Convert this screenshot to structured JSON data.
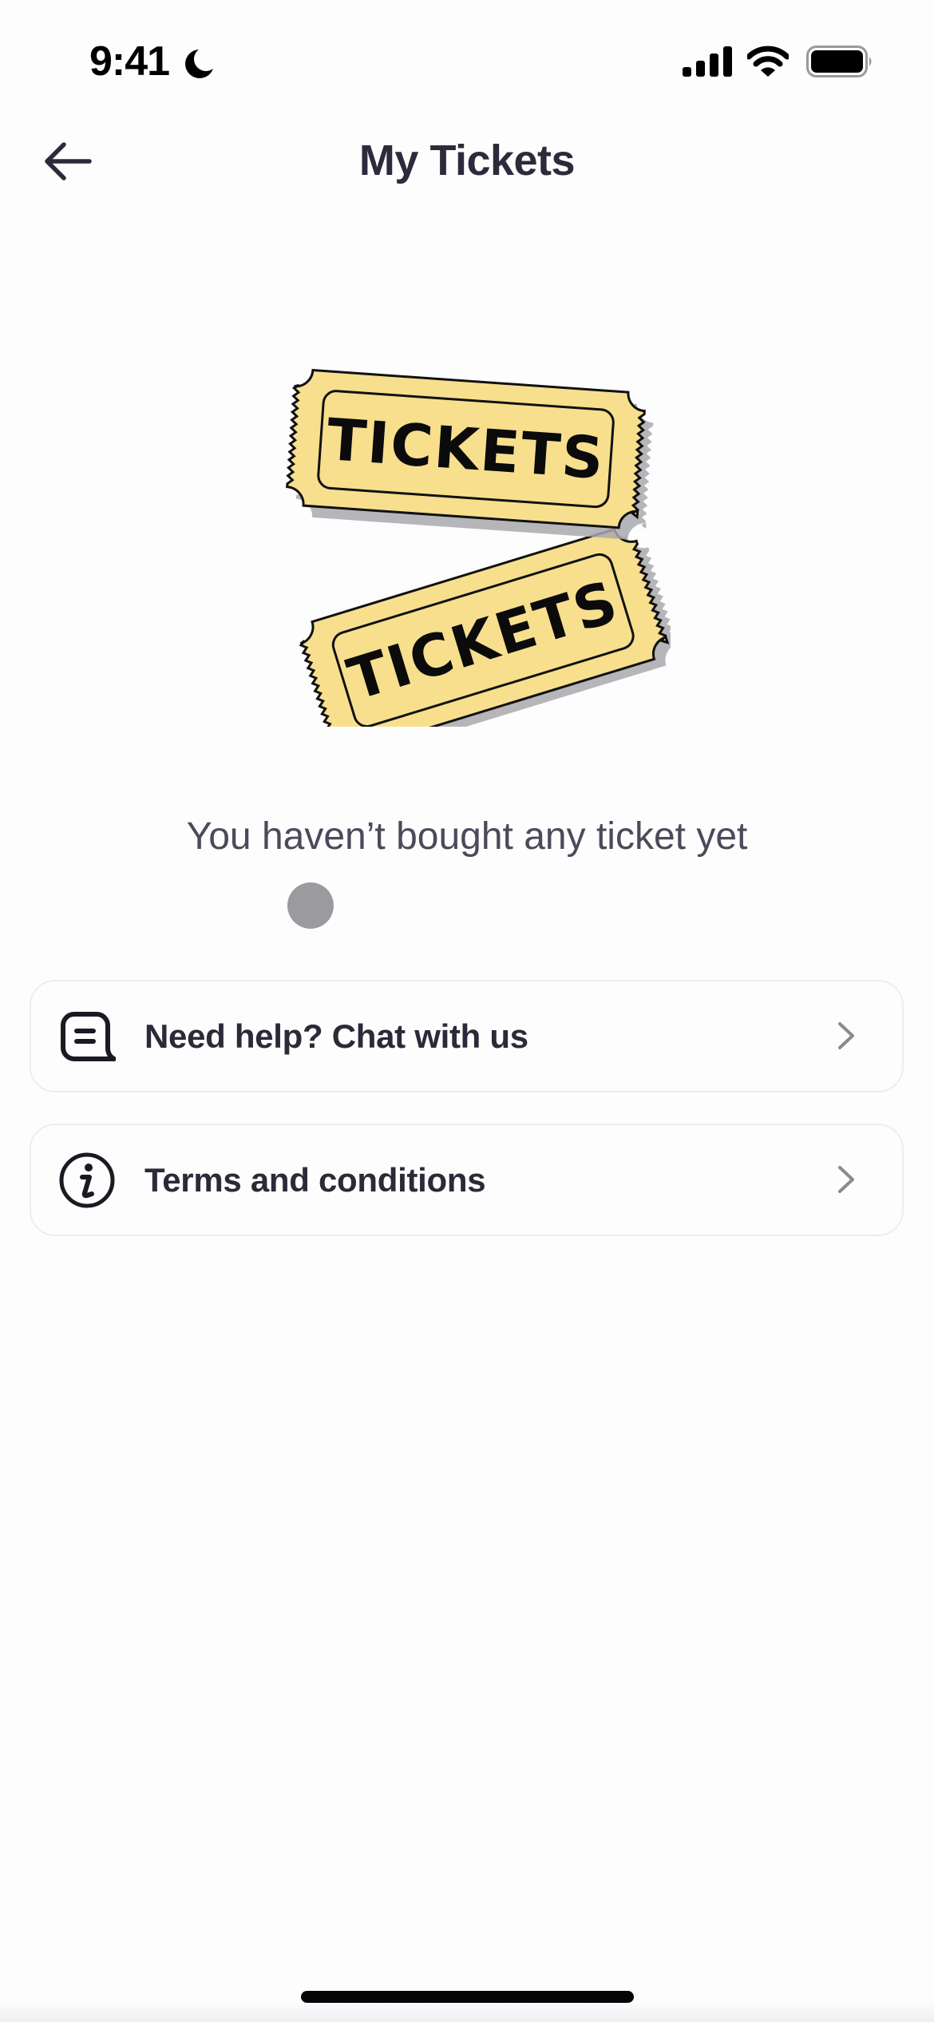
{
  "status_bar": {
    "time": "9:41",
    "focus_mode_icon": "moon-icon",
    "signal_icon": "cellular-signal-icon",
    "wifi_icon": "wifi-icon",
    "battery_icon": "battery-icon",
    "battery_level_percent": 100
  },
  "header": {
    "back_icon": "arrow-left-icon",
    "title": "My Tickets"
  },
  "illustration": {
    "name": "tickets-illustration",
    "ticket_text": "TICKETS",
    "ticket_count": 2,
    "colors": {
      "ticket_fill": "#f7df8e",
      "ticket_outline": "#111111",
      "shadow": "#a9a8ad"
    }
  },
  "empty_state": {
    "message": "You haven’t bought any ticket yet"
  },
  "list": {
    "items": [
      {
        "id": "chat",
        "icon": "chat-bubble-icon",
        "label": "Need help? Chat with us",
        "trailing_icon": "chevron-right-icon"
      },
      {
        "id": "terms",
        "icon": "info-circle-icon",
        "label": "Terms and conditions",
        "trailing_icon": "chevron-right-icon"
      }
    ]
  },
  "colors": {
    "background": "#fdfdfe",
    "primary_text": "#2a2a38",
    "secondary_text": "#4a4a5a",
    "card_border": "#ededf0",
    "chevron": "#8a8a90",
    "touch_indicator": "#9b9a9f"
  }
}
